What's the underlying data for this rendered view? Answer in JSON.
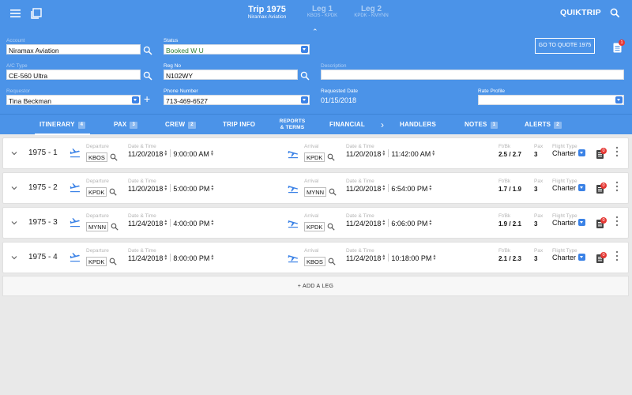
{
  "header": {
    "title": "Trip 1975",
    "subtitle": "Niramax Aviation",
    "legs_nav": [
      {
        "label": "Leg 1",
        "route": "KBOS - KPDK"
      },
      {
        "label": "Leg 2",
        "route": "KPDK - KMYNN"
      }
    ],
    "quiktrip": "QUIKTRIP"
  },
  "form": {
    "account": {
      "label": "Account",
      "value": "Niramax Aviation"
    },
    "status": {
      "label": "Status",
      "value": "Booked W U"
    },
    "quote_button": "GO TO QUOTE 1975",
    "doc_badge": "1",
    "ac_type": {
      "label": "A/C Type",
      "value": "CE-560 Ultra"
    },
    "reg_no": {
      "label": "Reg No",
      "value": "N102WY"
    },
    "description": {
      "label": "Description",
      "value": ""
    },
    "requestor": {
      "label": "Requestor",
      "value": "Tina Beckman"
    },
    "phone": {
      "label": "Phone Number",
      "value": "713-469-6527"
    },
    "requested_date": {
      "label": "Requested Date",
      "value": "01/15/2018"
    },
    "rate_profile": {
      "label": "Rate Profile",
      "value": ""
    }
  },
  "tabs": [
    {
      "label": "ITINERARY",
      "count": "4"
    },
    {
      "label": "PAX",
      "count": "3"
    },
    {
      "label": "CREW",
      "count": "2"
    },
    {
      "label": "TRIP INFO",
      "count": ""
    },
    {
      "label": "REPORTS",
      "label2": "& TERMS",
      "count": ""
    },
    {
      "label": "FINANCIAL",
      "count": ""
    },
    {
      "label": "HANDLERS",
      "count": ""
    },
    {
      "label": "NOTES",
      "count": "1"
    },
    {
      "label": "ALERTS",
      "count": "2"
    }
  ],
  "leg_labels": {
    "departure": "Departure",
    "datetime": "Date & Time",
    "arrival": "Arrival",
    "ftbk": "Ft/Bk",
    "pax": "Pax",
    "flight_type": "Flight Type"
  },
  "legs": [
    {
      "id": "1975 - 1",
      "dep": "KBOS",
      "dep_date": "11/20/2018",
      "dep_time": "9:00:00 AM",
      "arr": "KPDK",
      "arr_date": "11/20/2018",
      "arr_time": "11:42:00 AM",
      "ftbk": "2.5 / 2.7",
      "pax": "3",
      "ftype": "Charter",
      "badge": "0"
    },
    {
      "id": "1975 - 2",
      "dep": "KPDK",
      "dep_date": "11/20/2018",
      "dep_time": "5:00:00 PM",
      "arr": "MYNN",
      "arr_date": "11/20/2018",
      "arr_time": "6:54:00 PM",
      "ftbk": "1.7 / 1.9",
      "pax": "3",
      "ftype": "Charter",
      "badge": "0"
    },
    {
      "id": "1975 - 3",
      "dep": "MYNN",
      "dep_date": "11/24/2018",
      "dep_time": "4:00:00 PM",
      "arr": "KPDK",
      "arr_date": "11/24/2018",
      "arr_time": "6:06:00 PM",
      "ftbk": "1.9 / 2.1",
      "pax": "3",
      "ftype": "Charter",
      "badge": "0"
    },
    {
      "id": "1975 - 4",
      "dep": "KPDK",
      "dep_date": "11/24/2018",
      "dep_time": "8:00:00 PM",
      "arr": "KBOS",
      "arr_date": "11/24/2018",
      "arr_time": "10:18:00 PM",
      "ftbk": "2.1 / 2.3",
      "pax": "3",
      "ftype": "Charter",
      "badge": "0"
    }
  ],
  "add_leg": "+  ADD A LEG"
}
